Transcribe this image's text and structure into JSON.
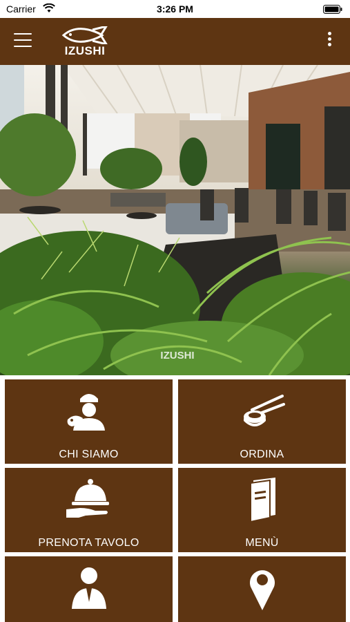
{
  "status_bar": {
    "carrier": "Carrier",
    "time": "3:26 PM"
  },
  "header": {
    "logo_text": "IZUSHI",
    "menu_icon": "hamburger-icon",
    "more_icon": "kebab-icon"
  },
  "hero": {
    "watermark": "IZUSHI"
  },
  "tiles": [
    {
      "label": "CHI SIAMO",
      "icon": "chef-icon"
    },
    {
      "label": "ORDINA",
      "icon": "sushi-chopsticks-icon"
    },
    {
      "label": "PRENOTA TAVOLO",
      "icon": "cloche-icon"
    },
    {
      "label": "MENÙ",
      "icon": "menu-book-icon"
    },
    {
      "label": "",
      "icon": "person-icon"
    },
    {
      "label": "",
      "icon": "location-pin-icon"
    }
  ],
  "colors": {
    "brand_brown": "#5e3512",
    "text": "#ffffff"
  }
}
